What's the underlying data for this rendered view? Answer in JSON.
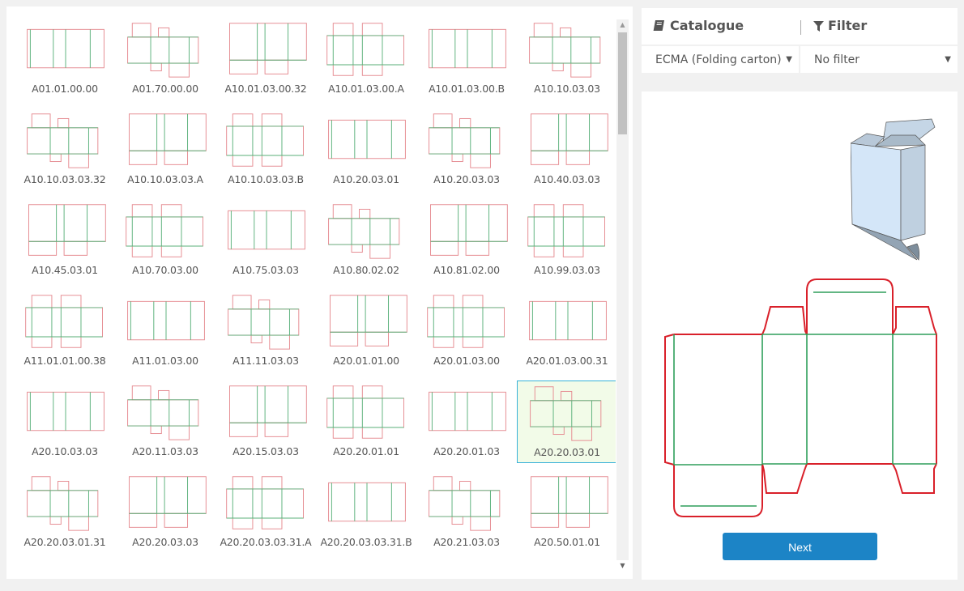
{
  "catalogue_panel": {
    "title": "Catalogue",
    "icon": "book-icon",
    "selected_value": "ECMA (Folding carton)"
  },
  "filter_panel": {
    "title": "Filter",
    "icon": "filter-icon",
    "selected_value": "No filter"
  },
  "grid": {
    "selected_item": "A20.20.03.01",
    "items": [
      {
        "code": "A01.01.00.00"
      },
      {
        "code": "A01.70.00.00"
      },
      {
        "code": "A10.01.03.00.32"
      },
      {
        "code": "A10.01.03.00.A"
      },
      {
        "code": "A10.01.03.00.B"
      },
      {
        "code": "A10.10.03.03"
      },
      {
        "code": "A10.10.03.03.32"
      },
      {
        "code": "A10.10.03.03.A"
      },
      {
        "code": "A10.10.03.03.B"
      },
      {
        "code": "A10.20.03.01"
      },
      {
        "code": "A10.20.03.03"
      },
      {
        "code": "A10.40.03.03"
      },
      {
        "code": "A10.45.03.01"
      },
      {
        "code": "A10.70.03.00"
      },
      {
        "code": "A10.75.03.03"
      },
      {
        "code": "A10.80.02.02"
      },
      {
        "code": "A10.81.02.00"
      },
      {
        "code": "A10.99.03.03"
      },
      {
        "code": "A11.01.01.00.38"
      },
      {
        "code": "A11.01.03.00"
      },
      {
        "code": "A11.11.03.03"
      },
      {
        "code": "A20.01.01.00"
      },
      {
        "code": "A20.01.03.00"
      },
      {
        "code": "A20.01.03.00.31"
      },
      {
        "code": "A20.10.03.03"
      },
      {
        "code": "A20.11.03.03"
      },
      {
        "code": "A20.15.03.03"
      },
      {
        "code": "A20.20.01.01"
      },
      {
        "code": "A20.20.01.03"
      },
      {
        "code": "A20.20.03.01"
      },
      {
        "code": "A20.20.03.01.31"
      },
      {
        "code": "A20.20.03.03"
      },
      {
        "code": "A20.20.03.03.31.A"
      },
      {
        "code": "A20.20.03.03.31.B"
      },
      {
        "code": "A20.21.03.03"
      },
      {
        "code": "A20.50.01.01"
      }
    ]
  },
  "preview": {
    "next_label": "Next"
  },
  "colors": {
    "cut_line": "#d9202a",
    "crease_line": "#2e9e5a",
    "accent": "#1c84c6",
    "selection_border": "#36b1d8",
    "selection_fill": "#f2fbe8"
  }
}
